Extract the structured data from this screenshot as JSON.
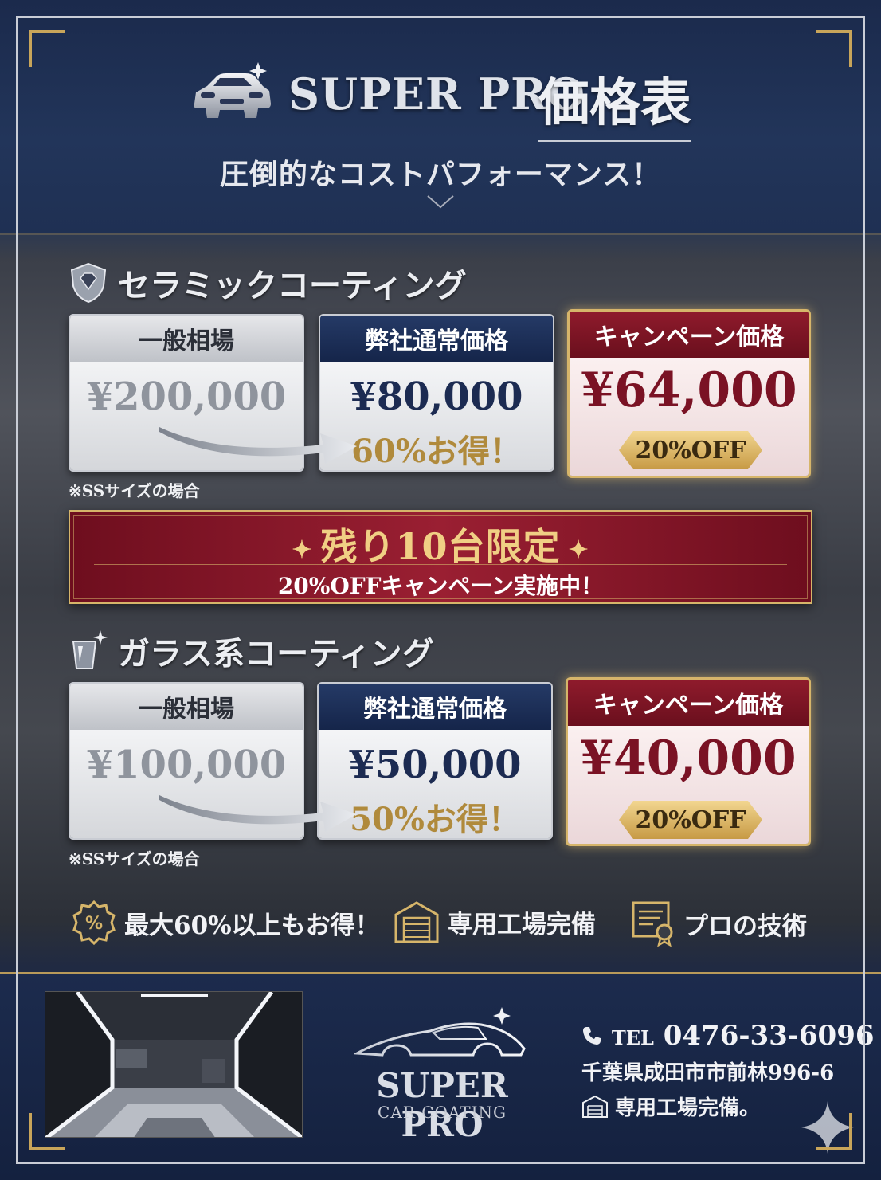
{
  "header": {
    "title_en": "SUPER PRO",
    "title_jp": "価格表",
    "subtitle": "圧倒的なコストパフォーマンス！"
  },
  "sections": [
    {
      "title": "セラミックコーティング",
      "icon": "diamond-shield-icon",
      "general": {
        "label": "一般相場",
        "price": "¥200,000"
      },
      "normal": {
        "label": "弊社通常価格",
        "price": "¥80,000",
        "saving": "60%お得！"
      },
      "campaign": {
        "label": "キャンペーン価格",
        "price": "¥64,000",
        "badge": "20%OFF"
      },
      "note": "※SSサイズの場合"
    },
    {
      "title": "ガラス系コーティング",
      "icon": "glass-sparkle-icon",
      "general": {
        "label": "一般相場",
        "price": "¥100,000"
      },
      "normal": {
        "label": "弊社通常価格",
        "price": "¥50,000",
        "saving": "50%お得！"
      },
      "campaign": {
        "label": "キャンペーン価格",
        "price": "¥40,000",
        "badge": "20%OFF"
      },
      "note": "※SSサイズの場合"
    }
  ],
  "banner": {
    "main": "残り10台限定",
    "sub": "20%OFFキャンペーン実施中！"
  },
  "features": [
    {
      "icon": "percent-badge-icon",
      "label": "最大60%以上もお得！"
    },
    {
      "icon": "garage-icon",
      "label": "専用工場完備"
    },
    {
      "icon": "certificate-icon",
      "label": "プロの技術"
    }
  ],
  "footer": {
    "logo_en": "SUPER PRO",
    "logo_sub": "CAR COATING",
    "tel_label": "TEL",
    "tel": "0476-33-6096",
    "address": "千葉県成田市市前林996-6",
    "facility": "専用工場完備。"
  },
  "colors": {
    "navy": "#1c2b52",
    "gold": "#d6b56a",
    "crimson": "#7a1224"
  }
}
